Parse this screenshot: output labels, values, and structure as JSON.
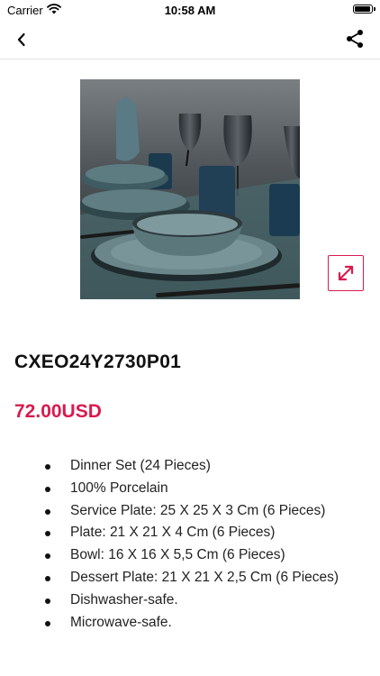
{
  "status_bar": {
    "carrier": "Carrier",
    "time": "10:58 AM",
    "battery_level": 0.95
  },
  "nav": {
    "back_icon": "chevron-left-icon",
    "share_icon": "share-icon"
  },
  "product": {
    "code": "CXEO24Y2730P01",
    "price": "72.00USD",
    "expand_icon": "expand-icon",
    "accent_color": "#d81b4f",
    "features": [
      "Dinner Set (24 Pieces)",
      "100% Porcelain",
      "Service Plate: 25 X 25 X 3 Cm (6 Pieces)",
      "Plate: 21 X 21 X 4 Cm (6 Pieces)",
      "Bowl: 16 X 16 X 5,5 Cm (6 Pieces)",
      "Dessert Plate: 21 X 21 X 2,5 Cm (6 Pieces)",
      "Dishwasher-safe.",
      "Microwave-safe."
    ]
  }
}
